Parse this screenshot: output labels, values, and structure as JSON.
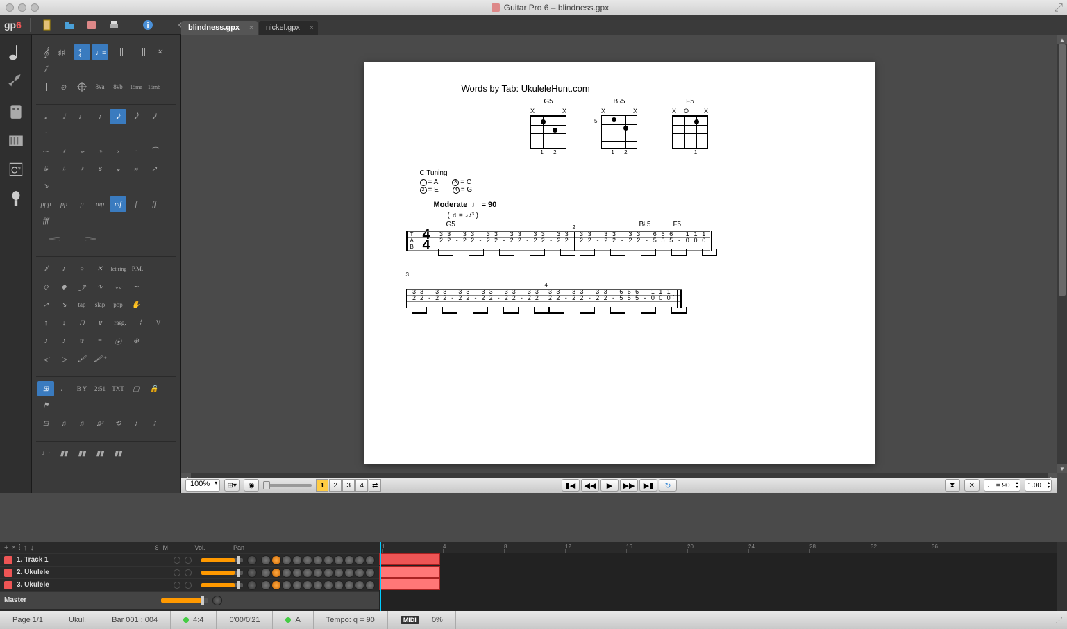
{
  "window": {
    "title": "Guitar Pro 6 – blindness.gpx"
  },
  "tabs": [
    {
      "label": "blindness.gpx",
      "active": true
    },
    {
      "label": "nickel.gpx",
      "active": false
    }
  ],
  "logoText": "gp",
  "logoSix": "6",
  "palette": {
    "dynamics": [
      "ppp",
      "pp",
      "p",
      "mp",
      "mf",
      "f",
      "ff",
      "fff"
    ],
    "dynamics_sel_idx": 4,
    "octaves": [
      "8va",
      "8vb",
      "15ma",
      "15mb"
    ],
    "techniques_row1": [
      "tap",
      "slap",
      "pop"
    ],
    "rasg": "rasg.",
    "pm": "P.M.",
    "letring": "let ring",
    "tr": "tr",
    "bar_labels": [
      "B Y",
      "2:51",
      "TXT"
    ],
    "v_label": "V"
  },
  "doc": {
    "byline": "Words by Tab: UkuleleHunt.com",
    "chords": [
      {
        "name": "G5",
        "top": [
          "X",
          "",
          "",
          "X"
        ],
        "fingers": [
          "",
          "1",
          "2",
          ""
        ]
      },
      {
        "name": "B♭5",
        "top": [
          "X",
          "",
          "",
          "X"
        ],
        "fingers": [
          "",
          "1",
          "2",
          ""
        ],
        "barre5": "5"
      },
      {
        "name": "F5",
        "top": [
          "X",
          "O",
          "",
          "X"
        ],
        "fingers": [
          "",
          "",
          "1",
          ""
        ]
      }
    ],
    "tuning": {
      "label": "C Tuning",
      "items": [
        {
          "n": "1",
          "note": "= A"
        },
        {
          "n": "3",
          "note": "= C"
        },
        {
          "n": "2",
          "note": "= E"
        },
        {
          "n": "4",
          "note": "= G"
        }
      ]
    },
    "tempo": {
      "label": "Moderate",
      "value": "= 90"
    },
    "tab_letters": "T\nA\nB",
    "timesig_top": "4",
    "timesig_bot": "4",
    "line1_chords": [
      "G5",
      "B♭5",
      "F5"
    ],
    "bar_numbers": [
      "2",
      "3",
      "4"
    ],
    "measures": [
      {
        "cols": [
          [
            "3",
            "2"
          ],
          [
            "3",
            "2"
          ],
          [
            "",
            "-"
          ],
          [
            "3",
            "2"
          ],
          [
            "3",
            "2"
          ],
          [
            "",
            "-"
          ],
          [
            "3",
            "2"
          ],
          [
            "3",
            "2"
          ],
          [
            "",
            "-"
          ],
          [
            "3",
            "2"
          ],
          [
            "3",
            "2"
          ],
          [
            "",
            "-"
          ],
          [
            "3",
            "2"
          ],
          [
            "3",
            "2"
          ],
          [
            "",
            "-"
          ],
          [
            "3",
            "2"
          ],
          [
            "3",
            "2"
          ]
        ]
      },
      {
        "cols": [
          [
            "3",
            "2"
          ],
          [
            "3",
            "2"
          ],
          [
            "",
            "-"
          ],
          [
            "3",
            "2"
          ],
          [
            "3",
            "2"
          ],
          [
            "",
            "-"
          ],
          [
            "3",
            "2"
          ],
          [
            "3",
            "2"
          ],
          [
            "",
            "-"
          ],
          [
            "6",
            "5"
          ],
          [
            "6",
            "5"
          ],
          [
            "6",
            "5"
          ],
          [
            "",
            "-"
          ],
          [
            "1",
            "0"
          ],
          [
            "1",
            "0"
          ],
          [
            "1",
            "0"
          ]
        ]
      },
      {
        "cols": [
          [
            "3",
            "2"
          ],
          [
            "3",
            "2"
          ],
          [
            "",
            "-"
          ],
          [
            "3",
            "2"
          ],
          [
            "3",
            "2"
          ],
          [
            "",
            "-"
          ],
          [
            "3",
            "2"
          ],
          [
            "3",
            "2"
          ],
          [
            "",
            "-"
          ],
          [
            "3",
            "2"
          ],
          [
            "3",
            "2"
          ],
          [
            "",
            "-"
          ],
          [
            "3",
            "2"
          ],
          [
            "3",
            "2"
          ],
          [
            "",
            "-"
          ],
          [
            "3",
            "2"
          ],
          [
            "3",
            "2"
          ]
        ]
      },
      {
        "cols": [
          [
            "3",
            "2"
          ],
          [
            "3",
            "2"
          ],
          [
            "",
            "-"
          ],
          [
            "3",
            "2"
          ],
          [
            "3",
            "2"
          ],
          [
            "",
            "-"
          ],
          [
            "3",
            "2"
          ],
          [
            "3",
            "2"
          ],
          [
            "",
            "-"
          ],
          [
            "6",
            "5"
          ],
          [
            "6",
            "5"
          ],
          [
            "6",
            "5"
          ],
          [
            "",
            "-"
          ],
          [
            "1",
            "0"
          ],
          [
            "1",
            "0"
          ],
          [
            "1",
            "0"
          ]
        ]
      }
    ]
  },
  "viewbar": {
    "zoom": "100%",
    "voices": [
      "1",
      "2",
      "3",
      "4"
    ],
    "active_voice": 0,
    "tempo_disp": "= 90",
    "speed": "1.00"
  },
  "tracks": {
    "header": {
      "solo": "S",
      "mute": "M",
      "vol": "Vol.",
      "pan": "Pan"
    },
    "ruler_marks": [
      "1",
      "4",
      "8",
      "12",
      "16",
      "20",
      "24",
      "28",
      "32",
      "36"
    ],
    "rows": [
      {
        "name": "1. Track 1",
        "vol": 80,
        "kn": 52
      },
      {
        "name": "2. Ukulele",
        "vol": 80,
        "kn": 52
      },
      {
        "name": "3. Ukulele",
        "vol": 80,
        "kn": 52
      }
    ],
    "master": "Master"
  },
  "status": {
    "page": "Page 1/1",
    "instrument": "Ukul.",
    "bar": "Bar 001 : 004",
    "sig": "4:4",
    "time": "0'00/0'21",
    "key": "A",
    "tempo": "Tempo: q = 90",
    "midi": "MIDI",
    "pct": "0%"
  }
}
